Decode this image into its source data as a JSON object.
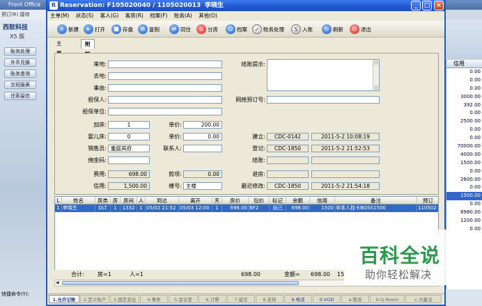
{
  "background_app": {
    "title": "Front Office",
    "menu": "预订(R)  接待",
    "logo": "西软科技",
    "version": "X5 版",
    "side_buttons": [
      "账务处理",
      "外币兑换",
      "账务查询",
      "交班报表",
      "住客留信"
    ],
    "shortcut_label": "快捷命令(Y):",
    "right_col_header": "信用",
    "right_col_values": [
      "0.00",
      "0.00",
      "0.00",
      "3000.00",
      "392.00",
      "0.00",
      "2500.00",
      "0.00",
      "0.00",
      "70000.00",
      "4000.00",
      "1500.00",
      "0.00",
      "2600.00",
      "0.00",
      "1500.00",
      "0.00",
      "8980.00",
      "1200.00",
      "0.00"
    ],
    "right_col_selected_index": 15
  },
  "window": {
    "title": "Reservation: F105020040 / 1105020013",
    "guest_name": "李晓生",
    "minimize_label": "_",
    "maximize_label": "□",
    "close_label": "×"
  },
  "menubar": [
    "主单(M)",
    "状态(S)",
    "客人(G)",
    "客房(R)",
    "档案(F)",
    "账务(A)",
    "其他(O)"
  ],
  "toolbar": [
    {
      "label": "新建",
      "icon": "new-doc-icon"
    },
    {
      "label": "打开",
      "icon": "open-icon"
    },
    {
      "label": "存盘",
      "icon": "save-icon"
    },
    {
      "label": "复制",
      "icon": "copy-icon"
    },
    {
      "label": "同住",
      "icon": "share-icon"
    },
    {
      "label": "分房",
      "icon": "room-icon"
    },
    {
      "label": "档案",
      "icon": "profile-icon"
    },
    {
      "label": "账务处理",
      "icon": "account-icon"
    },
    {
      "label": "入账",
      "icon": "post-icon"
    },
    {
      "label": "刷新",
      "icon": "refresh-icon"
    },
    {
      "label": "退出",
      "icon": "exit-icon"
    }
  ],
  "tabs": [
    {
      "label": "主要信息",
      "active": false
    },
    {
      "label": "附加信息",
      "active": true
    }
  ],
  "form": {
    "from_label": "来地:",
    "from_value": "",
    "to_label": "去地:",
    "to_value": "",
    "reason_label": "事由:",
    "reason_value": "",
    "guarantor_label": "担保人:",
    "guarantor_value": "",
    "guarantor_unit_label": "担保单位:",
    "guarantor_unit_value": "",
    "checkout_hint_label": "结账提示:",
    "checkout_hint_value": "",
    "online_booking_label": "网络预订号:",
    "online_booking_value": "",
    "extra_bed_label": "加床:",
    "extra_bed_value": "1",
    "extra_bed_price_label": "单价:",
    "extra_bed_price_value": "200.00",
    "crib_label": "婴儿床:",
    "crib_value": "0",
    "crib_price_label": "单价:",
    "crib_price_value": "0.00",
    "sales_label": "销售员:",
    "sales_value": "重庭宾府",
    "contact_label": "联系人:",
    "contact_value": "",
    "commission_label": "佣金码:",
    "commission_value": "",
    "cost_label": "费用:",
    "cost_value": "698.00",
    "item_label": "款项:",
    "item_value": "0.00",
    "credit_label": "信用:",
    "credit_value": "1,500.00",
    "building_label": "楼号:",
    "building_value": "主楼",
    "created_label": "建立:",
    "created_user": "CDC-0142",
    "created_time": "2011-5-2 10:08:19",
    "registered_label": "登记:",
    "registered_user": "CDC-1850",
    "registered_time": "2011-5-2 21:52:53",
    "settled_label": "结账:",
    "settled_user": "",
    "settled_time": "",
    "checkout_label": "退房:",
    "checkout_user": "",
    "checkout_time": "",
    "modified_label": "最近修改:",
    "modified_user": "CDC-1850",
    "modified_time": "2011-5-2 21:54:18"
  },
  "grid": {
    "headers": [
      "L",
      "姓名",
      "房类",
      "房",
      "房间",
      "人",
      "到达",
      "离开",
      "天",
      "房价",
      "包价",
      "标记",
      "余额",
      "信用",
      "备注",
      "预订"
    ],
    "row": [
      "1",
      "李晓生",
      "DLT",
      "1",
      "1332",
      "1",
      "05/02 21:52",
      "05/03 12:00",
      "1",
      "698.00",
      "BF2",
      "自己",
      "698.00",
      "1500",
      "非本人挂卡BOSS1500",
      "110502"
    ]
  },
  "totals": {
    "label": "合计:",
    "rooms": "房=1",
    "persons": "人=1",
    "amount": "698.00",
    "balance_label": "金额=",
    "balance": "698.00",
    "credit": "15"
  },
  "bottom_tabs": [
    "1.允许记账",
    "2.定义账户",
    "3.固定支出",
    "4.事务",
    "5.会议室",
    "6.订餐",
    "7.留言",
    "8.吉祥",
    "9.电话",
    "0.VOD",
    "a.租赁",
    "b.Q-Room",
    "c.大备注"
  ],
  "bottom_tab_active": 0,
  "watermark": {
    "line1": "百科全说",
    "line2": "助你轻松解决"
  }
}
